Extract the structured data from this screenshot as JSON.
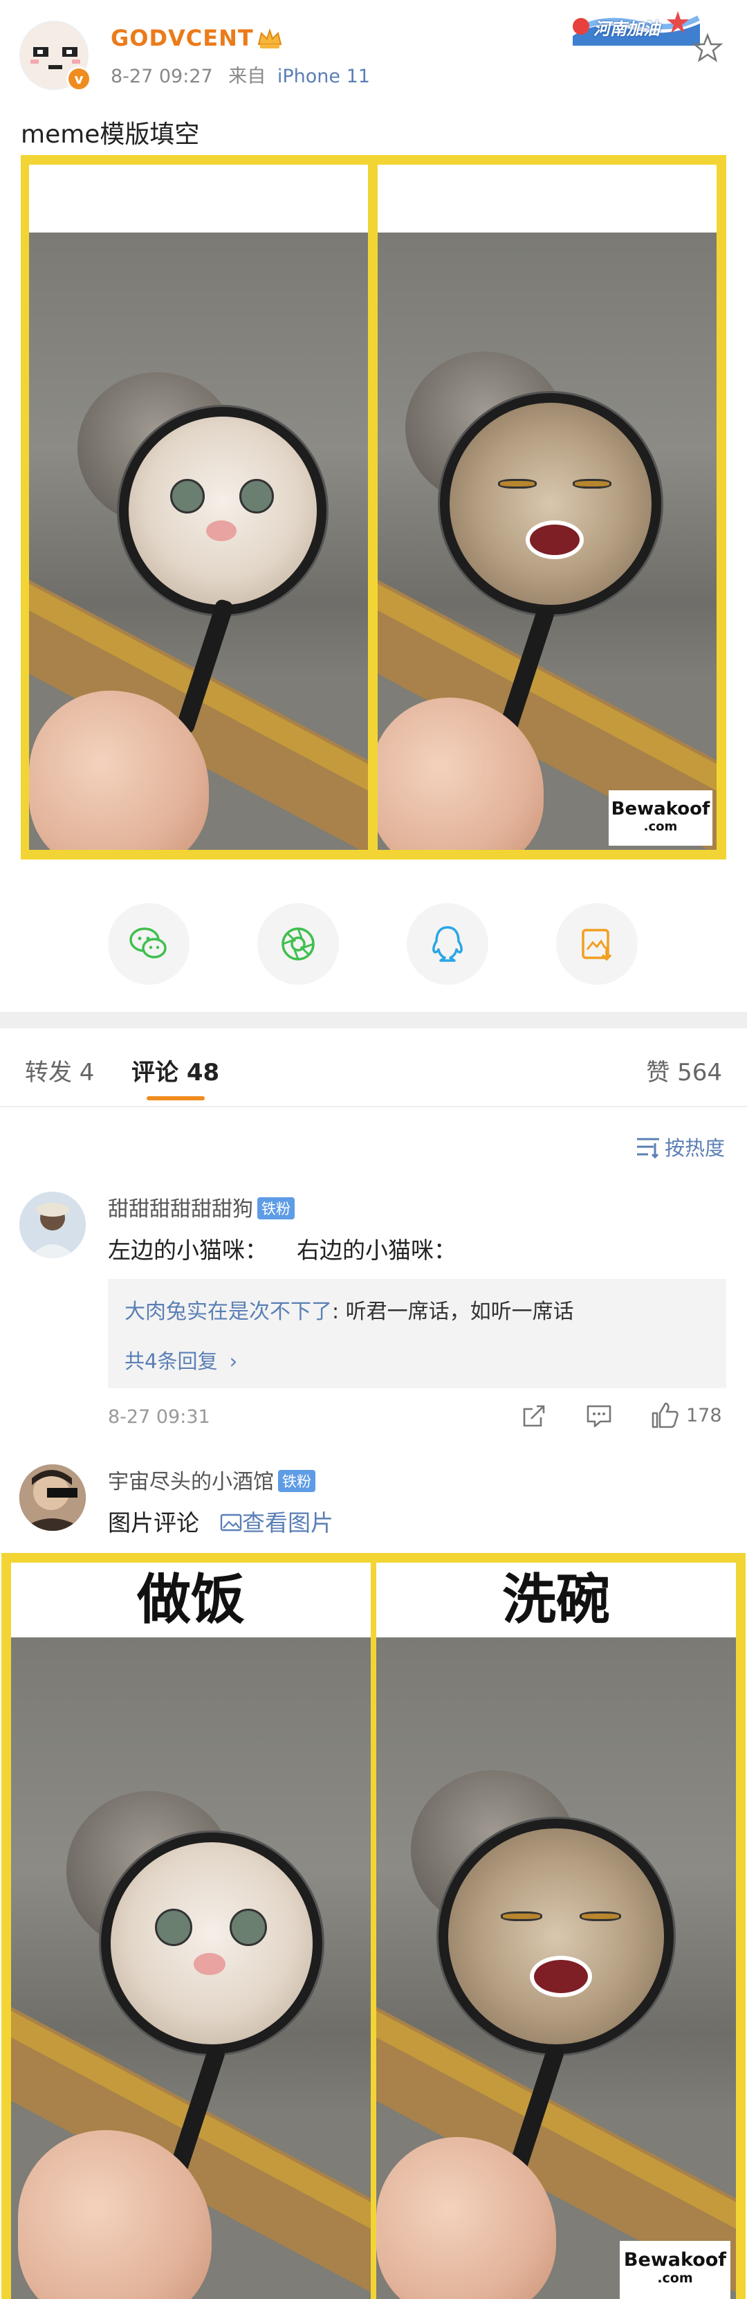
{
  "post": {
    "username": "GODVCENT",
    "timestamp": "8-27 09:27",
    "source_prefix": "来自",
    "device": "iPhone 11",
    "text": "meme模版填空",
    "badge_text": "河南加油",
    "image_watermark": [
      "Bewakoof",
      ".com"
    ]
  },
  "share_buttons": [
    "wechat-icon",
    "moments-icon",
    "qq-icon",
    "save-image-icon"
  ],
  "tabs": {
    "repost": "转发 4",
    "comments": "评论 48",
    "likes": "赞 564"
  },
  "sort_label": "按热度",
  "comments": [
    {
      "name": "甜甜甜甜甜甜狗",
      "badge": "铁粉",
      "text": "左边的小猫咪：    右边的小猫咪：",
      "reply": {
        "author": "大肉兔实在是次不下了",
        "text": ": 听君一席话，如听一席话"
      },
      "more_replies": "共4条回复",
      "date": "8-27 09:31",
      "likes": "178"
    },
    {
      "name": "宇宙尽头的小酒馆",
      "badge": "铁粉",
      "text": "图片评论",
      "image_link": "查看图片",
      "image_captions": [
        "做饭",
        "洗碗"
      ]
    }
  ],
  "colors": {
    "username": "#eb7b1a",
    "link": "#5a7fb5",
    "accent": "#f08c1e",
    "frame": "#f2d534"
  }
}
